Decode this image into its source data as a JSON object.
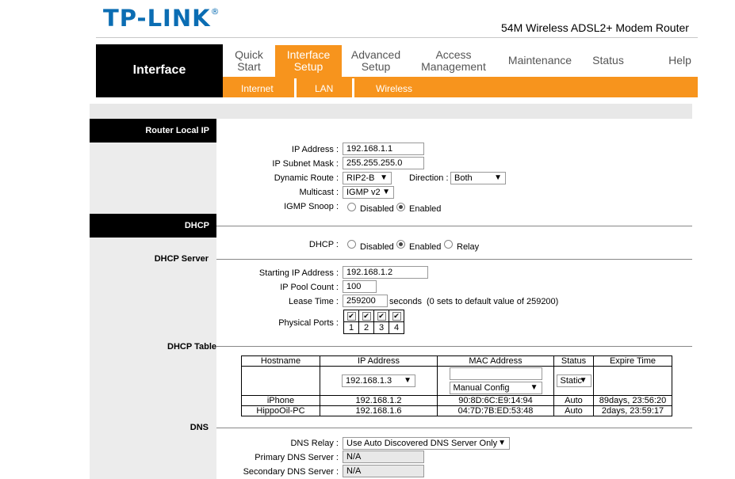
{
  "brand": {
    "logo_text": "TP-LINK",
    "registered": "®",
    "model": "54M Wireless ADSL2+ Modem Router"
  },
  "page_title": "Interface",
  "nav": {
    "tabs": [
      {
        "line1": "Quick",
        "line2": "Start"
      },
      {
        "line1": "Interface",
        "line2": "Setup",
        "active": true
      },
      {
        "line1": "Advanced",
        "line2": "Setup"
      },
      {
        "line1": "Access",
        "line2": "Management"
      },
      {
        "line1": "Maintenance",
        "line2": ""
      },
      {
        "line1": "Status",
        "line2": ""
      },
      {
        "line1": "Help",
        "line2": ""
      }
    ],
    "subtabs": [
      "Internet",
      "LAN",
      "Wireless"
    ]
  },
  "router_local_ip": {
    "header": "Router Local IP",
    "ip_label": "IP Address :",
    "ip_value": "192.168.1.1",
    "mask_label": "IP Subnet Mask :",
    "mask_value": "255.255.255.0",
    "route_label": "Dynamic Route :",
    "route_value": "RIP2-B",
    "direction_label": "Direction :",
    "direction_value": "Both",
    "multicast_label": "Multicast :",
    "multicast_value": "IGMP v2",
    "igmp_label": "IGMP Snoop :",
    "igmp_disabled": "Disabled",
    "igmp_enabled": "Enabled"
  },
  "dhcp": {
    "header": "DHCP",
    "dhcp_label": "DHCP :",
    "opt_disabled": "Disabled",
    "opt_enabled": "Enabled",
    "opt_relay": "Relay",
    "server_label": "DHCP Server",
    "start_label": "Starting IP Address :",
    "start_value": "192.168.1.2",
    "pool_label": "IP Pool Count :",
    "pool_value": "100",
    "lease_label": "Lease Time :",
    "lease_value": "259200",
    "lease_unit": "seconds",
    "lease_note": "(0 sets to default value of 259200)",
    "ports_label": "Physical Ports :",
    "ports": [
      "1",
      "2",
      "3",
      "4"
    ],
    "table_label": "DHCP Table",
    "table": {
      "headers": [
        "Hostname",
        "IP Address",
        "MAC Address",
        "Status",
        "Expire Time"
      ],
      "input_row": {
        "ip_select": "192.168.1.3",
        "mac_mode": "Manual Config",
        "status_select": "Static"
      },
      "rows": [
        [
          "iPhone",
          "192.168.1.2",
          "90:8D:6C:E9:14:94",
          "Auto",
          "89days, 23:56:20"
        ],
        [
          "HippoOil-PC",
          "192.168.1.6",
          "04:7D:7B:ED:53:48",
          "Auto",
          "2days, 23:59:17"
        ]
      ]
    }
  },
  "dns": {
    "label": "DNS",
    "relay_label": "DNS Relay :",
    "relay_value": "Use Auto Discovered DNS Server Only",
    "primary_label": "Primary DNS Server :",
    "primary_value": "N/A",
    "secondary_label": "Secondary DNS Server :",
    "secondary_value": "N/A"
  },
  "colors": {
    "accent": "#f7941d",
    "logo": "#0b6db3",
    "header_black": "#000000"
  }
}
